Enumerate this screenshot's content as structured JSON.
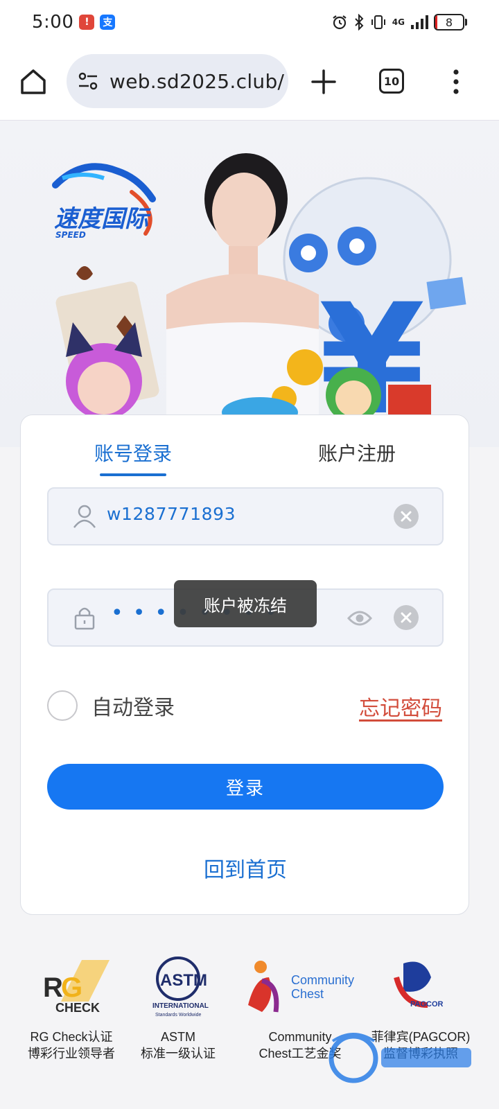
{
  "status_bar": {
    "time": "5:00",
    "network": "4G",
    "battery": "8",
    "battery_level": 0.08,
    "icons": [
      "notification-red-icon",
      "alipay-icon",
      "alarm-icon",
      "bluetooth-icon",
      "vibrate-icon",
      "signal-icon",
      "battery-icon"
    ]
  },
  "browser": {
    "url": "web.sd2025.club/",
    "tab_count": "10",
    "icons": [
      "home-icon",
      "site-settings-icon",
      "new-tab-plus-icon",
      "tab-switcher-icon",
      "overflow-menu-icon"
    ]
  },
  "hero": {
    "logo_text": "速度国际",
    "logo_subtext": "SPEED"
  },
  "login_card": {
    "tabs": [
      {
        "label": "账号登录",
        "active": true
      },
      {
        "label": "账户注册",
        "active": false
      }
    ],
    "username_value": "w1287771893",
    "password_masked": "••••••••",
    "toast": "账户被冻结",
    "remember_label": "自动登录",
    "forgot_label": "忘记密码",
    "login_button": "登录",
    "home_link": "回到首页"
  },
  "badges": [
    {
      "logo": "RG CHECK",
      "caption_1": "RG Check认证",
      "caption_2": "博彩行业领导者"
    },
    {
      "logo": "ASTM INTERNATIONAL",
      "caption_1": "ASTM",
      "caption_2": "标准一级认证"
    },
    {
      "logo": "Community Chest",
      "caption_1": "Community",
      "caption_2": "Chest工艺金奖"
    },
    {
      "logo": "PAGCOR",
      "caption_1": "菲律宾(PAGCOR)",
      "caption_2": "监督博彩执照"
    }
  ],
  "colors": {
    "accent": "#1677f2",
    "link_blue": "#1a6fd1",
    "forgot_red": "#d24c3b",
    "toast_bg": "#3c3c3c"
  }
}
